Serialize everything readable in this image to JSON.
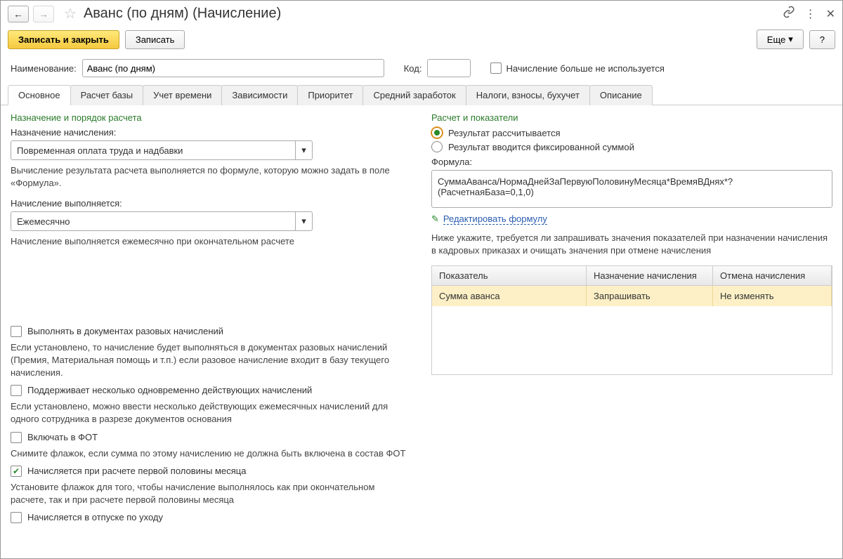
{
  "title": "Аванс (по дням) (Начисление)",
  "toolbar": {
    "save_close": "Записать и закрыть",
    "save": "Записать",
    "more": "Еще",
    "help": "?"
  },
  "form": {
    "name_label": "Наименование:",
    "name_value": "Аванс (по дням)",
    "code_label": "Код:",
    "code_value": "",
    "not_used_label": "Начисление больше не используется"
  },
  "tabs": [
    "Основное",
    "Расчет базы",
    "Учет времени",
    "Зависимости",
    "Приоритет",
    "Средний заработок",
    "Налоги, взносы, бухучет",
    "Описание"
  ],
  "left": {
    "section": "Назначение и порядок расчета",
    "assign_label": "Назначение начисления:",
    "assign_value": "Повременная оплата труда и надбавки",
    "assign_hint": "Вычисление результата расчета выполняется по формуле, которую можно задать в поле «Формула».",
    "exec_label": "Начисление выполняется:",
    "exec_value": "Ежемесячно",
    "exec_hint": "Начисление выполняется ежемесячно при окончательном расчете",
    "cb_once": "Выполнять в документах разовых начислений",
    "cb_once_hint": "Если установлено, то начисление будет выполняться в документах разовых начислений (Премия, Материальная помощь и т.п.) если разовое начисление входит в базу текущего начисления.",
    "cb_multi": "Поддерживает несколько одновременно действующих начислений",
    "cb_multi_hint": "Если установлено, можно ввести несколько действующих ежемесячных начислений для одного сотрудника в разрезе документов основания",
    "cb_fot": "Включать в ФОТ",
    "cb_fot_hint": "Снимите флажок, если сумма по этому начислению не должна быть включена в состав ФОТ",
    "cb_firsthalf": "Начисляется при расчете первой половины месяца",
    "cb_firsthalf_hint": "Установите флажок для того, чтобы начисление выполнялось как при окончательном расчете, так и при расчете первой половины месяца",
    "cb_leave": "Начисляется в отпуске по уходу"
  },
  "right": {
    "section": "Расчет и показатели",
    "radio_calc": "Результат рассчитывается",
    "radio_fixed": "Результат вводится фиксированной суммой",
    "formula_label": "Формула:",
    "formula_value": "СуммаАванса/НормаДнейЗаПервуюПоловинуМесяца*ВремяВДнях*?(РасчетнаяБаза=0,1,0)",
    "edit_link": "Редактировать формулу",
    "grid_hint": "Ниже укажите, требуется ли запрашивать значения показателей при назначении начисления в кадровых приказах и очищать значения при отмене начисления",
    "grid_headers": [
      "Показатель",
      "Назначение начисления",
      "Отмена начисления"
    ],
    "grid_row": [
      "Сумма аванса",
      "Запрашивать",
      "Не изменять"
    ]
  }
}
